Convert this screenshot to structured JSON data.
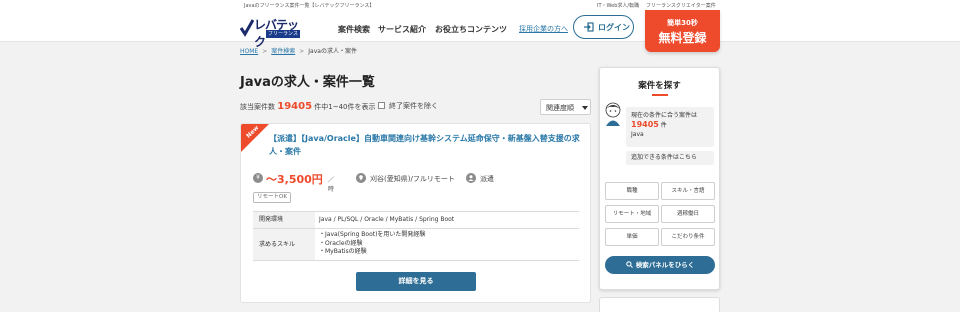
{
  "topstrip": {
    "tagline": "Javaのフリーランス案件一覧【レバテックフリーランス】",
    "link1": "IT・Web求人/転職",
    "link2": "フリーランスクリエイター案件"
  },
  "header": {
    "logo_text": "レバテック",
    "logo_sub": "フリーランス",
    "nav": [
      "案件検索",
      "サービス紹介",
      "お役立ちコンテンツ"
    ],
    "corp_link": "採用企業の方へ",
    "login_label": "ログイン",
    "register_small": "簡単30秒",
    "register_big": "無料登録"
  },
  "breadcrumb": {
    "home": "HOME",
    "search": "案件検索",
    "current": "Javaの求人・案件"
  },
  "page": {
    "title": "Javaの求人・案件一覧",
    "count_prefix": "該当案件数",
    "count": "19405",
    "count_suffix": "件中1~40件を表示",
    "exclude_label": "終了案件を除く",
    "sort_label": "関連度順"
  },
  "job": {
    "badge": "New",
    "title": "【派遣】【Java/Oracle】自動車関連向け基幹システム延命保守・新基盤入替支援の求人・案件",
    "price": "～3,500円",
    "price_unit": "／時",
    "location": "刈谷(愛知県)/フルリモート",
    "type": "派遣",
    "tag": "リモートOK",
    "spec": {
      "env_label": "開発環境",
      "env_value": "Java / PL/SQL / Oracle / MyBatis / Spring Boot",
      "skill_label": "求めるスキル",
      "skills": [
        "・Java(Spring Boot)を用いた開発経験",
        "・Oracleの経験",
        "・MyBatisの経験"
      ]
    },
    "detail_button": "詳細を見る"
  },
  "sidebar": {
    "title": "案件を探す",
    "current_text": "現在の条件に合う案件は",
    "current_count": "19405",
    "count_unit": "件",
    "current_skill": "Java",
    "addable": "追加できる条件はこちら",
    "buttons": [
      "職種",
      "スキル・言語",
      "リモート・地域",
      "週稼働日",
      "単価",
      "こだわり条件"
    ],
    "search_button": "検索パネルをひらく"
  },
  "colors": {
    "accent": "#ee4a2c",
    "primary": "#2e6e96",
    "link": "#2a78a8"
  }
}
